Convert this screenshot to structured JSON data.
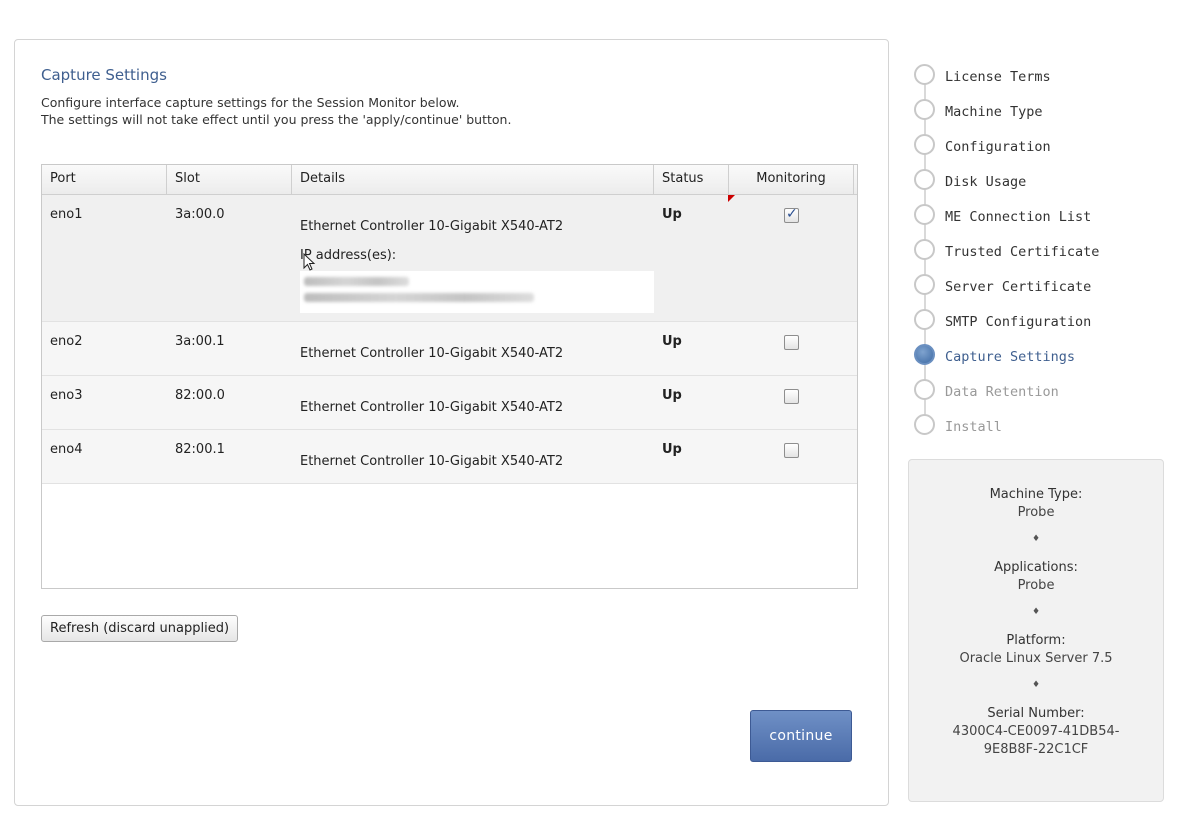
{
  "page": {
    "title": "Capture Settings",
    "description_line1": "Configure interface capture settings for the Session Monitor below.",
    "description_line2": "The settings will not take effect until you press the 'apply/continue' button."
  },
  "table": {
    "columns": [
      "Port",
      "Slot",
      "Details",
      "Status",
      "Monitoring"
    ],
    "ip_label": "IP address(es):",
    "rows": [
      {
        "port": "eno1",
        "slot": "3a:00.0",
        "details": "Ethernet Controller 10-Gigabit X540-AT2",
        "status": "Up",
        "monitoring": true
      },
      {
        "port": "eno2",
        "slot": "3a:00.1",
        "details": "Ethernet Controller 10-Gigabit X540-AT2",
        "status": "Up",
        "monitoring": false
      },
      {
        "port": "eno3",
        "slot": "82:00.0",
        "details": "Ethernet Controller 10-Gigabit X540-AT2",
        "status": "Up",
        "monitoring": false
      },
      {
        "port": "eno4",
        "slot": "82:00.1",
        "details": "Ethernet Controller 10-Gigabit X540-AT2",
        "status": "Up",
        "monitoring": false
      }
    ]
  },
  "buttons": {
    "refresh": "Refresh (discard unapplied)",
    "continue": "continue"
  },
  "steps": [
    {
      "label": "License Terms",
      "state": "done"
    },
    {
      "label": "Machine Type",
      "state": "done"
    },
    {
      "label": "Configuration",
      "state": "done"
    },
    {
      "label": "Disk Usage",
      "state": "done"
    },
    {
      "label": "ME Connection List",
      "state": "done"
    },
    {
      "label": "Trusted Certificate",
      "state": "done"
    },
    {
      "label": "Server Certificate",
      "state": "done"
    },
    {
      "label": "SMTP Configuration",
      "state": "done"
    },
    {
      "label": "Capture Settings",
      "state": "active"
    },
    {
      "label": "Data Retention",
      "state": "future"
    },
    {
      "label": "Install",
      "state": "future"
    }
  ],
  "info": {
    "machine_type_label": "Machine Type:",
    "machine_type_value": "Probe",
    "applications_label": "Applications:",
    "applications_value": "Probe",
    "platform_label": "Platform:",
    "platform_value": "Oracle Linux Server 7.5",
    "serial_label": "Serial Number:",
    "serial_line1": "4300C4-CE0097-41DB54-",
    "serial_line2": "9E8B8F-22C1CF",
    "separator": "♦"
  },
  "colors": {
    "accent": "#3f5f8f",
    "button": "#5a7bb6",
    "dirty_flag": "#cc0000"
  },
  "icons": {
    "separator": "diamond-separator-icon",
    "cursor": "mouse-pointer-icon",
    "step": "step-circle-icon"
  }
}
